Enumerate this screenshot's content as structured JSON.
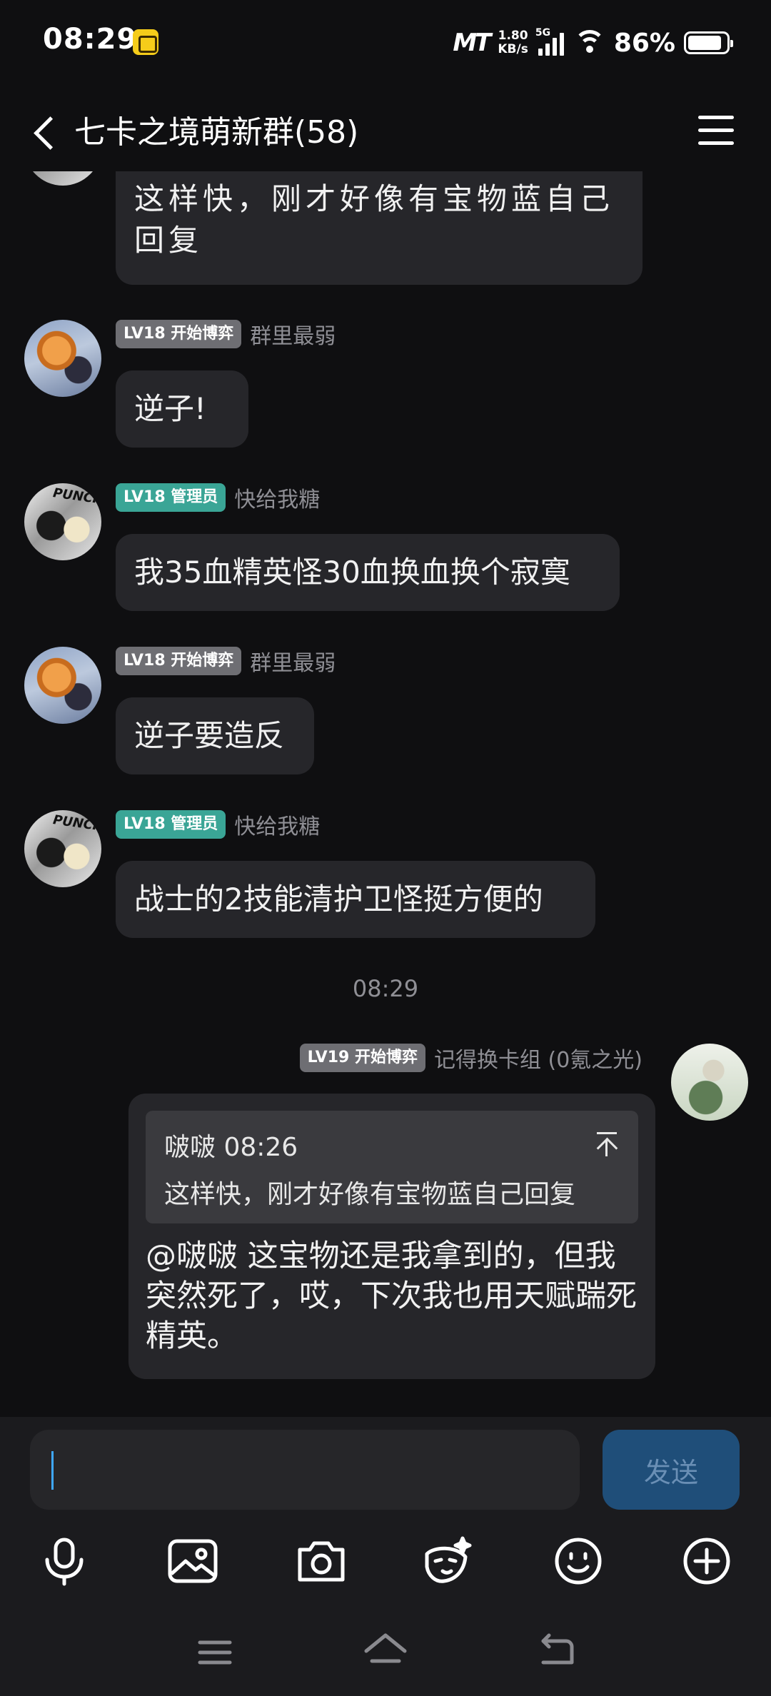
{
  "status_bar": {
    "time": "08:29",
    "net_logo": "MT",
    "net_speed_value": "1.80",
    "net_speed_unit": "KB/s",
    "signal_gen": "5G",
    "battery": "86%"
  },
  "header": {
    "title": "七卡之境萌新群(58)"
  },
  "messages": [
    {
      "type": "text",
      "text": "这样快，刚才好像有宝物蓝自己回复"
    },
    {
      "type": "text",
      "level": "LV18 开始博弈",
      "badge_color": "#6e6e73",
      "sender": "群里最弱",
      "text": "逆子!"
    },
    {
      "type": "text",
      "level": "LV18 管理员",
      "badge_color": "#3aa596",
      "sender": "快给我糖",
      "text": "我35血精英怪30血换血换个寂寞"
    },
    {
      "type": "text",
      "level": "LV18 开始博弈",
      "badge_color": "#6e6e73",
      "sender": "群里最弱",
      "text": "逆子要造反"
    },
    {
      "type": "text",
      "level": "LV18 管理员",
      "badge_color": "#3aa596",
      "sender": "快给我糖",
      "text": "战士的2技能清护卫怪挺方便的"
    },
    {
      "type": "timestamp",
      "text": "08:29"
    },
    {
      "type": "reply",
      "level": "LV19 开始博弈",
      "badge_color": "#6e6e73",
      "sender": "记得换卡组 (0氪之光)",
      "quote_head": "啵啵 08:26",
      "quote_text": "这样快，刚才好像有宝物蓝自己回复",
      "text": "@啵啵 这宝物还是我拿到的，但我突然死了，哎，下次我也用天赋踹死精英。"
    }
  ],
  "input": {
    "value": "",
    "send_label": "发送"
  },
  "toolbar_icons": [
    "microphone-icon",
    "image-icon",
    "camera-icon",
    "sticker-icon",
    "emoji-icon",
    "plus-icon"
  ],
  "nav_icons": [
    "menu-nav-icon",
    "home-nav-icon",
    "back-nav-icon"
  ],
  "colors": {
    "background": "#0f0f11",
    "bubble": "#26262a",
    "accent": "#3fa8ff",
    "send_button": "#1f4e79"
  }
}
